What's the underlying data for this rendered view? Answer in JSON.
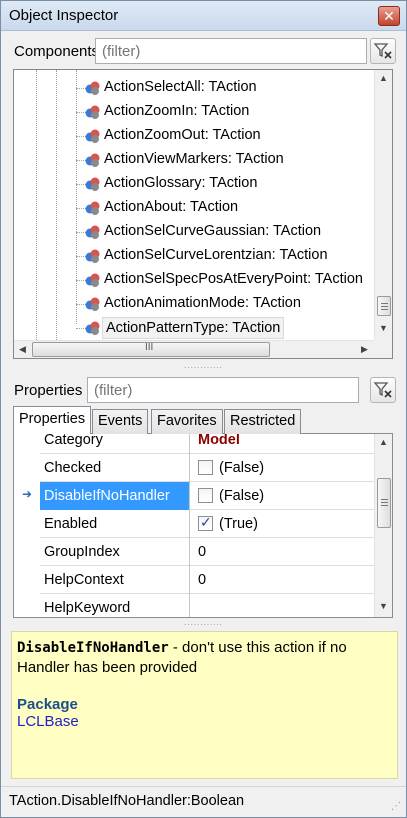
{
  "window": {
    "title": "Object Inspector",
    "close_symbol": "✕"
  },
  "components": {
    "label": "Components",
    "filter_placeholder": "(filter)",
    "items": [
      "ActionSelectAll: TAction",
      "ActionZoomIn: TAction",
      "ActionZoomOut: TAction",
      "ActionViewMarkers: TAction",
      "ActionGlossary: TAction",
      "ActionAbout: TAction",
      "ActionSelCurveGaussian: TAction",
      "ActionSelCurveLorentzian: TAction",
      "ActionSelSpecPosAtEveryPoint: TAction",
      "ActionAnimationMode: TAction",
      "ActionPatternType: TAction"
    ],
    "selected_item": "ActionPatternType: TAction",
    "item_icon": "action-component-icon",
    "scroll_up": "▲",
    "scroll_down": "▼",
    "scroll_left": "◀",
    "scroll_right": "▶",
    "hscroll_grip": "III"
  },
  "splitter_grip": "............",
  "properties": {
    "label": "Properties",
    "filter_placeholder": "(filter)",
    "tabs": [
      "Properties",
      "Events",
      "Favorites",
      "Restricted"
    ],
    "active_tab": "Properties",
    "selection_pointer": "➜",
    "rows": [
      {
        "name": "Category",
        "value": "Model",
        "kind": "category"
      },
      {
        "name": "Checked",
        "value": "(False)",
        "kind": "checkbox",
        "checked": false
      },
      {
        "name": "DisableIfNoHandler",
        "value": "(False)",
        "kind": "checkbox",
        "checked": false,
        "selected": true
      },
      {
        "name": "Enabled",
        "value": "(True)",
        "kind": "checkbox",
        "checked": true
      },
      {
        "name": "GroupIndex",
        "value": "0",
        "kind": "text"
      },
      {
        "name": "HelpContext",
        "value": "0",
        "kind": "text"
      },
      {
        "name": "HelpKeyword",
        "value": "",
        "kind": "text"
      }
    ],
    "check_mark": "✓"
  },
  "help": {
    "identifier": "DisableIfNoHandler",
    "description": " - don't use this action if no Handler has been provided",
    "package_label": "Package",
    "unit": "LCLBase"
  },
  "status": {
    "text": "TAction.DisableIfNoHandler:Boolean",
    "size_grip": "⋰"
  },
  "colors": {
    "selection": "#3399ff",
    "help_background": "#ffffc4",
    "category_value": "#8b0000"
  }
}
